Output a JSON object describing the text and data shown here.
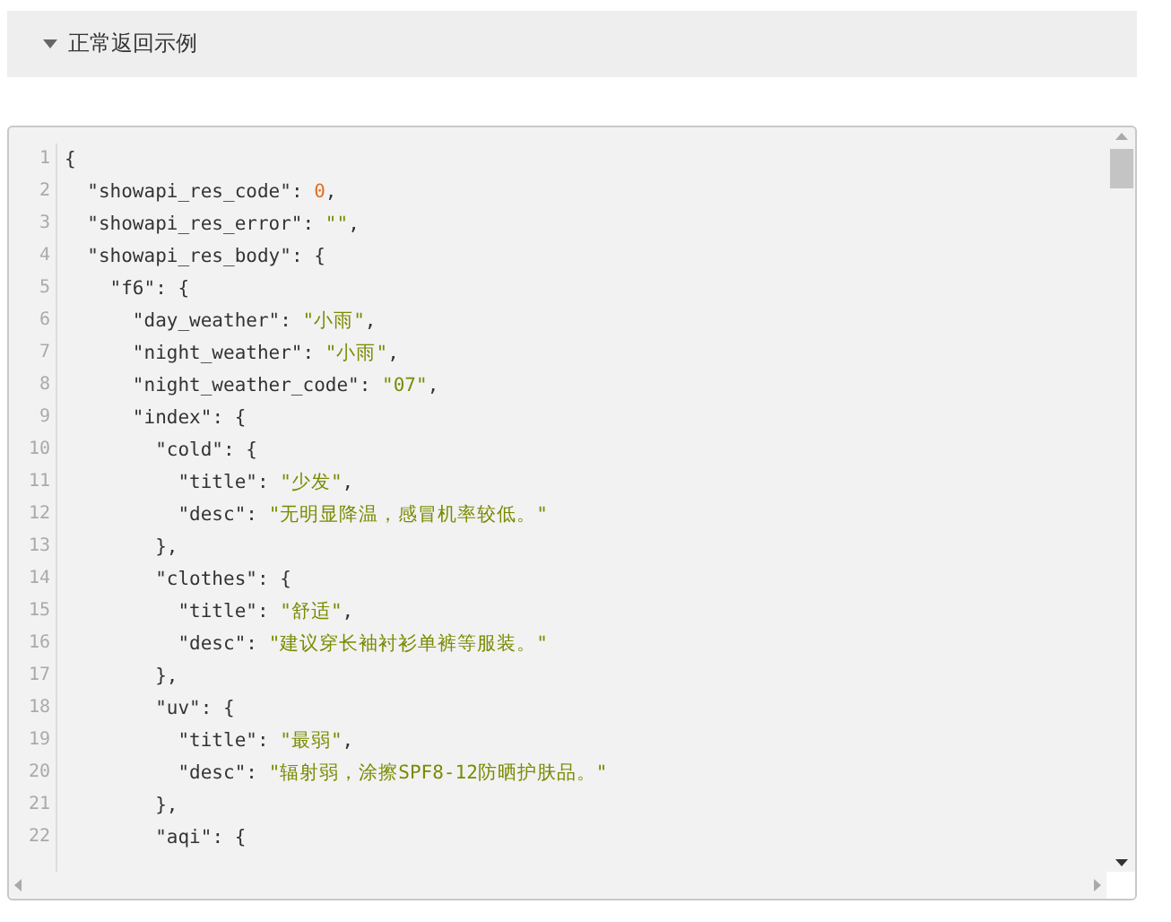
{
  "section": {
    "title": "正常返回示例",
    "expanded": true
  },
  "code_lines": [
    {
      "number": "1",
      "tokens": [
        {
          "kind": "punct",
          "text": "{"
        }
      ]
    },
    {
      "number": "2",
      "tokens": [
        {
          "kind": "key",
          "text": "  \"showapi_res_code\""
        },
        {
          "kind": "punct",
          "text": ": "
        },
        {
          "kind": "number",
          "text": "0"
        },
        {
          "kind": "punct",
          "text": ","
        }
      ]
    },
    {
      "number": "3",
      "tokens": [
        {
          "kind": "key",
          "text": "  \"showapi_res_error\""
        },
        {
          "kind": "punct",
          "text": ": "
        },
        {
          "kind": "string",
          "text": "\"\""
        },
        {
          "kind": "punct",
          "text": ","
        }
      ]
    },
    {
      "number": "4",
      "tokens": [
        {
          "kind": "key",
          "text": "  \"showapi_res_body\""
        },
        {
          "kind": "punct",
          "text": ": {"
        }
      ]
    },
    {
      "number": "5",
      "tokens": [
        {
          "kind": "key",
          "text": "    \"f6\""
        },
        {
          "kind": "punct",
          "text": ": {"
        }
      ]
    },
    {
      "number": "6",
      "tokens": [
        {
          "kind": "key",
          "text": "      \"day_weather\""
        },
        {
          "kind": "punct",
          "text": ": "
        },
        {
          "kind": "string",
          "text": "\"小雨\""
        },
        {
          "kind": "punct",
          "text": ","
        }
      ]
    },
    {
      "number": "7",
      "tokens": [
        {
          "kind": "key",
          "text": "      \"night_weather\""
        },
        {
          "kind": "punct",
          "text": ": "
        },
        {
          "kind": "string",
          "text": "\"小雨\""
        },
        {
          "kind": "punct",
          "text": ","
        }
      ]
    },
    {
      "number": "8",
      "tokens": [
        {
          "kind": "key",
          "text": "      \"night_weather_code\""
        },
        {
          "kind": "punct",
          "text": ": "
        },
        {
          "kind": "string",
          "text": "\"07\""
        },
        {
          "kind": "punct",
          "text": ","
        }
      ]
    },
    {
      "number": "9",
      "tokens": [
        {
          "kind": "key",
          "text": "      \"index\""
        },
        {
          "kind": "punct",
          "text": ": {"
        }
      ]
    },
    {
      "number": "10",
      "tokens": [
        {
          "kind": "key",
          "text": "        \"cold\""
        },
        {
          "kind": "punct",
          "text": ": {"
        }
      ]
    },
    {
      "number": "11",
      "tokens": [
        {
          "kind": "key",
          "text": "          \"title\""
        },
        {
          "kind": "punct",
          "text": ": "
        },
        {
          "kind": "string",
          "text": "\"少发\""
        },
        {
          "kind": "punct",
          "text": ","
        }
      ]
    },
    {
      "number": "12",
      "tokens": [
        {
          "kind": "key",
          "text": "          \"desc\""
        },
        {
          "kind": "punct",
          "text": ": "
        },
        {
          "kind": "string",
          "text": "\"无明显降温，感冒机率较低。\""
        }
      ]
    },
    {
      "number": "13",
      "tokens": [
        {
          "kind": "punct",
          "text": "        },"
        }
      ]
    },
    {
      "number": "14",
      "tokens": [
        {
          "kind": "key",
          "text": "        \"clothes\""
        },
        {
          "kind": "punct",
          "text": ": {"
        }
      ]
    },
    {
      "number": "15",
      "tokens": [
        {
          "kind": "key",
          "text": "          \"title\""
        },
        {
          "kind": "punct",
          "text": ": "
        },
        {
          "kind": "string",
          "text": "\"舒适\""
        },
        {
          "kind": "punct",
          "text": ","
        }
      ]
    },
    {
      "number": "16",
      "tokens": [
        {
          "kind": "key",
          "text": "          \"desc\""
        },
        {
          "kind": "punct",
          "text": ": "
        },
        {
          "kind": "string",
          "text": "\"建议穿长袖衬衫单裤等服装。\""
        }
      ]
    },
    {
      "number": "17",
      "tokens": [
        {
          "kind": "punct",
          "text": "        },"
        }
      ]
    },
    {
      "number": "18",
      "tokens": [
        {
          "kind": "key",
          "text": "        \"uv\""
        },
        {
          "kind": "punct",
          "text": ": {"
        }
      ]
    },
    {
      "number": "19",
      "tokens": [
        {
          "kind": "key",
          "text": "          \"title\""
        },
        {
          "kind": "punct",
          "text": ": "
        },
        {
          "kind": "string",
          "text": "\"最弱\""
        },
        {
          "kind": "punct",
          "text": ","
        }
      ]
    },
    {
      "number": "20",
      "tokens": [
        {
          "kind": "key",
          "text": "          \"desc\""
        },
        {
          "kind": "punct",
          "text": ": "
        },
        {
          "kind": "string",
          "text": "\"辐射弱，涂擦SPF8-12防晒护肤品。\""
        }
      ]
    },
    {
      "number": "21",
      "tokens": [
        {
          "kind": "punct",
          "text": "        },"
        }
      ]
    },
    {
      "number": "22",
      "tokens": [
        {
          "kind": "key",
          "text": "        \"aqi\""
        },
        {
          "kind": "punct",
          "text": ": {"
        }
      ]
    }
  ]
}
